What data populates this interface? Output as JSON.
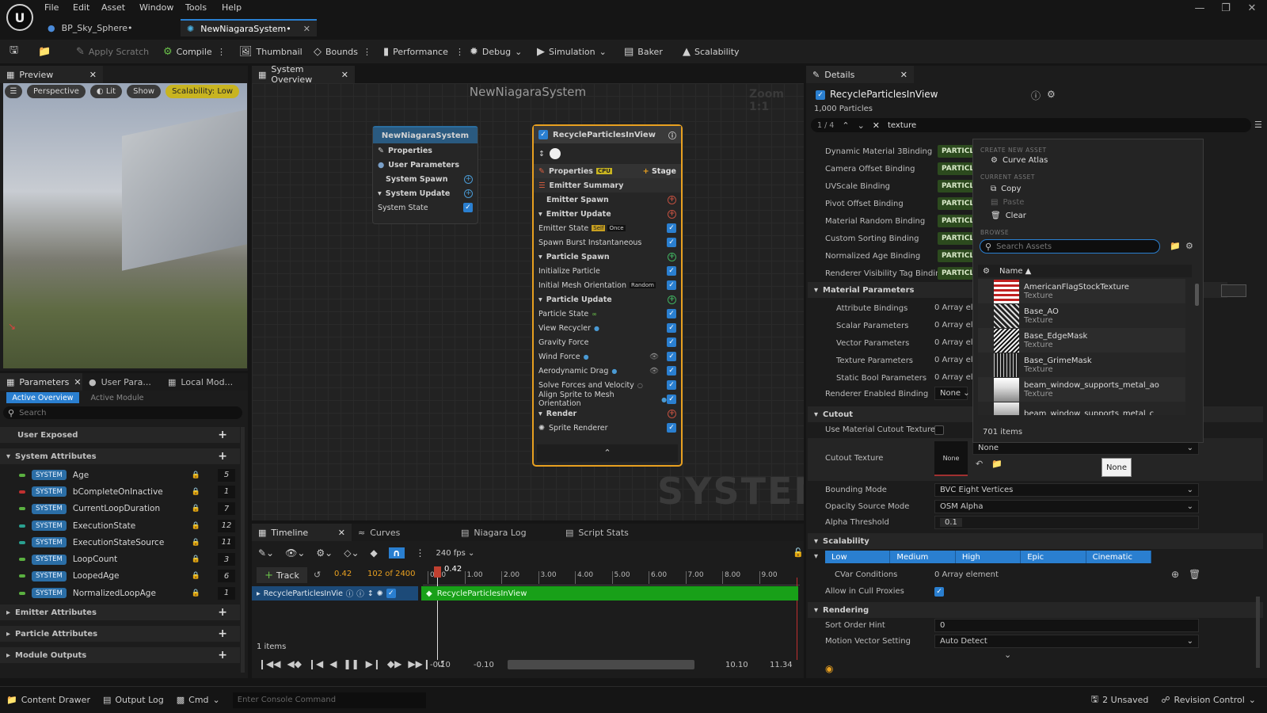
{
  "menu": [
    "File",
    "Edit",
    "Asset",
    "Window",
    "Tools",
    "Help"
  ],
  "tabs": [
    {
      "label": "BP_Sky_Sphere•"
    },
    {
      "label": "NewNiagaraSystem•"
    }
  ],
  "toolbar": {
    "apply_scratch": "Apply Scratch",
    "compile": "Compile",
    "thumbnail": "Thumbnail",
    "bounds": "Bounds",
    "performance": "Performance",
    "debug": "Debug",
    "simulation": "Simulation",
    "baker": "Baker",
    "scalability": "Scalability"
  },
  "preview": {
    "tab": "Preview",
    "perspective": "Perspective",
    "lit": "Lit",
    "show": "Show",
    "scalability": "Scalability: Low"
  },
  "params": {
    "tabs": [
      "Parameters",
      "User Para...",
      "Local Mod..."
    ],
    "active_overview": "Active Overview",
    "active_module": "Active Module",
    "search_placeholder": "Search",
    "user_exposed": "User Exposed",
    "system_attributes": "System Attributes",
    "items": [
      {
        "badge": "SYSTEM",
        "name": "Age",
        "value": "5",
        "color": "#5ab040"
      },
      {
        "badge": "SYSTEM",
        "name": "bCompleteOnInactive",
        "value": "1",
        "color": "#c03030"
      },
      {
        "badge": "SYSTEM",
        "name": "CurrentLoopDuration",
        "value": "7",
        "color": "#5ab040"
      },
      {
        "badge": "SYSTEM",
        "name": "ExecutionState",
        "value": "12",
        "color": "#2aa090"
      },
      {
        "badge": "SYSTEM",
        "name": "ExecutionStateSource",
        "value": "11",
        "color": "#2aa090"
      },
      {
        "badge": "SYSTEM",
        "name": "LoopCount",
        "value": "3",
        "color": "#5ab040"
      },
      {
        "badge": "SYSTEM",
        "name": "LoopedAge",
        "value": "6",
        "color": "#5ab040"
      },
      {
        "badge": "SYSTEM",
        "name": "NormalizedLoopAge",
        "value": "1",
        "color": "#5ab040"
      }
    ],
    "emitter_attributes": "Emitter Attributes",
    "particle_attributes": "Particle Attributes",
    "module_outputs": "Module Outputs"
  },
  "overview": {
    "tab": "System Overview",
    "title": "NewNiagaraSystem",
    "zoom": "Zoom 1:1",
    "watermark": "SYSTEM",
    "system_node": {
      "title": "NewNiagaraSystem",
      "rows": [
        "Properties",
        "User Parameters",
        "System Spawn",
        "System Update",
        "System State"
      ]
    },
    "emitter_node": {
      "title": "RecycleParticlesInView",
      "properties": "Properties",
      "stage": "Stage",
      "emitter_summary": "Emitter Summary",
      "emitter_spawn": "Emitter Spawn",
      "emitter_update": "Emitter Update",
      "emitter_state": "Emitter State",
      "self": "Self",
      "once": "Once",
      "spawn_burst": "Spawn Burst Instantaneous",
      "particle_spawn": "Particle Spawn",
      "initialize_particle": "Initialize Particle",
      "initial_mesh": "Initial Mesh Orientation",
      "random": "Random",
      "particle_update": "Particle Update",
      "particle_state": "Particle State",
      "view_recycler": "View Recycler",
      "gravity_force": "Gravity Force",
      "wind_force": "Wind Force",
      "aero_drag": "Aerodynamic Drag",
      "solve_forces": "Solve Forces and Velocity",
      "align_sprite": "Align Sprite to Mesh Orientation",
      "render": "Render",
      "sprite_renderer": "Sprite Renderer"
    }
  },
  "timeline": {
    "tabs": [
      "Timeline",
      "Curves",
      "Niagara Log",
      "Script Stats"
    ],
    "fps": "240 fps",
    "track": "Track",
    "time": "0.42",
    "frames": "102 of 2400",
    "playhead": "0.42",
    "ticks": [
      "0.00",
      "1.00",
      "2.00",
      "3.00",
      "4.00",
      "5.00",
      "6.00",
      "7.00",
      "8.00",
      "9.00"
    ],
    "track_name": "RecycleParticlesInVie",
    "bar_name": "RecycleParticlesInView",
    "items_count": "1 items",
    "range_start": "-0.10",
    "range_start2": "-0.10",
    "range_end": "10.10",
    "range_end2": "11.34"
  },
  "details": {
    "tab": "Details",
    "emitter": "RecycleParticlesInView",
    "particles": "1,000 Particles",
    "search_count": "1 / 4",
    "search_value": "texture",
    "bindings": [
      {
        "label": "Dynamic Material 3Binding"
      },
      {
        "label": "Camera Offset Binding"
      },
      {
        "label": "UVScale Binding"
      },
      {
        "label": "Pivot Offset Binding"
      },
      {
        "label": "Material Random Binding"
      },
      {
        "label": "Custom Sorting Binding"
      },
      {
        "label": "Normalized Age Binding"
      },
      {
        "label": "Renderer Visibility Tag Binding"
      }
    ],
    "particle_tag": "PARTICLE",
    "material_parameters": "Material Parameters",
    "mat_rows": [
      {
        "label": "Attribute Bindings",
        "value": "0 Array elem"
      },
      {
        "label": "Scalar Parameters",
        "value": "0 Array elem"
      },
      {
        "label": "Vector Parameters",
        "value": "0 Array elem"
      },
      {
        "label": "Texture Parameters",
        "value": "0 Array elem"
      },
      {
        "label": "Static Bool Parameters",
        "value": "0 Array elem"
      }
    ],
    "renderer_enabled": "Renderer Enabled Binding",
    "renderer_enabled_val": "None",
    "cutout": "Cutout",
    "use_cutout": "Use Material Cutout Texture",
    "cutout_texture": "Cutout Texture",
    "cutout_thumb": "None",
    "cutout_select": "None",
    "tooltip": "None",
    "bounding_mode": "Bounding Mode",
    "bounding_val": "BVC Eight Vertices",
    "opacity_source": "Opacity Source Mode",
    "opacity_val": "OSM Alpha",
    "alpha_threshold": "Alpha Threshold",
    "alpha_val": "0.1",
    "scalability": "Scalability",
    "levels": [
      "Low",
      "Medium",
      "High",
      "Epic",
      "Cinematic"
    ],
    "cvar": "CVar Conditions",
    "cvar_val": "0 Array element",
    "cull": "Allow in Cull Proxies",
    "rendering": "Rendering",
    "sort_order": "Sort Order Hint",
    "sort_val": "0",
    "motion_vector": "Motion Vector Setting",
    "motion_val": "Auto Detect"
  },
  "asset_menu": {
    "create_new": "CREATE NEW ASSET",
    "curve_atlas": "Curve Atlas",
    "current_asset": "CURRENT ASSET",
    "copy": "Copy",
    "paste": "Paste",
    "clear": "Clear",
    "browse": "BROWSE",
    "search_placeholder": "Search Assets",
    "name_col": "Name",
    "assets": [
      {
        "name": "AmericanFlagStockTexture",
        "type": "Texture"
      },
      {
        "name": "Base_AO",
        "type": "Texture"
      },
      {
        "name": "Base_EdgeMask",
        "type": "Texture"
      },
      {
        "name": "Base_GrimeMask",
        "type": "Texture"
      },
      {
        "name": "beam_window_supports_metal_ao",
        "type": "Texture"
      },
      {
        "name": "beam_window_supports_metal_c",
        "type": ""
      }
    ],
    "count": "701 items"
  },
  "statusbar": {
    "content_drawer": "Content Drawer",
    "output_log": "Output Log",
    "cmd": "Cmd",
    "console_placeholder": "Enter Console Command",
    "unsaved": "2 Unsaved",
    "revision": "Revision Control"
  }
}
